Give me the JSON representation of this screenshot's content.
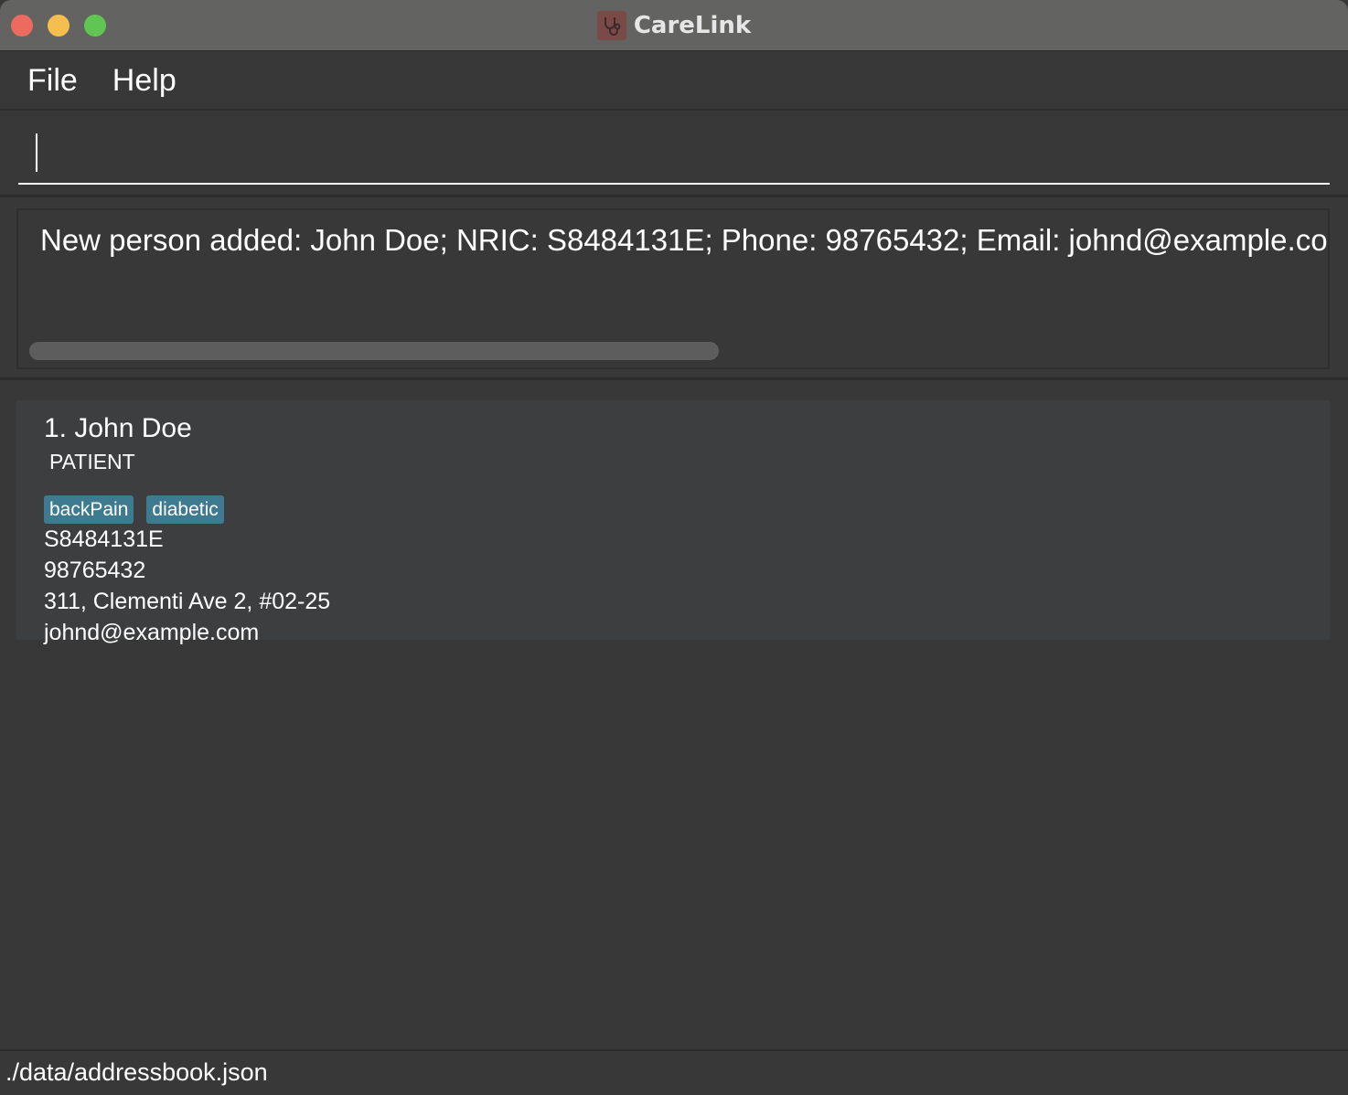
{
  "window": {
    "title": "CareLink"
  },
  "menu": {
    "items": [
      {
        "label": "File"
      },
      {
        "label": "Help"
      }
    ]
  },
  "command": {
    "value": "",
    "placeholder": ""
  },
  "result": {
    "message": "New person added: John Doe; NRIC: S8484131E; Phone: 98765432; Email: johnd@example.com"
  },
  "persons": [
    {
      "index_name": "1. John Doe",
      "role": "PATIENT",
      "tags": [
        "backPain",
        "diabetic"
      ],
      "nric": "S8484131E",
      "phone": "98765432",
      "address": "311, Clementi Ave 2, #02-25",
      "email": "johnd@example.com"
    }
  ],
  "status": {
    "path": "./data/addressbook.json"
  },
  "colors": {
    "background": "#383838",
    "titlebar": "#636362",
    "card": "#3c3e3f",
    "tag": "#3e7b91",
    "close": "#ed6a5e",
    "minimize": "#f5bf4f",
    "maximize": "#61c554"
  },
  "icons": {
    "app": "carelink-app-icon"
  }
}
